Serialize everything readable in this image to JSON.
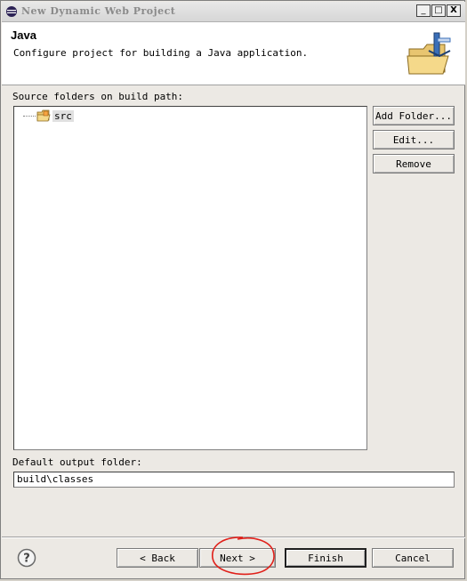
{
  "window": {
    "title": "New Dynamic Web Project",
    "minimize": "_",
    "maximize": "□",
    "close": "X"
  },
  "header": {
    "title": "Java",
    "description": "Configure project for building a Java application."
  },
  "source": {
    "label": "Source folders on build path:",
    "items": [
      {
        "label": "src"
      }
    ],
    "buttons": {
      "add": "Add Folder...",
      "edit": "Edit...",
      "remove": "Remove"
    }
  },
  "output": {
    "label": "Default output folder:",
    "value": "build\\classes"
  },
  "footer": {
    "back": "< Back",
    "next": "Next >",
    "finish": "Finish",
    "cancel": "Cancel"
  },
  "icons": {
    "title": "eclipse-icon",
    "folder": "source-folder-icon",
    "help": "help-icon",
    "wizard": "java-folder-wizard-icon"
  }
}
